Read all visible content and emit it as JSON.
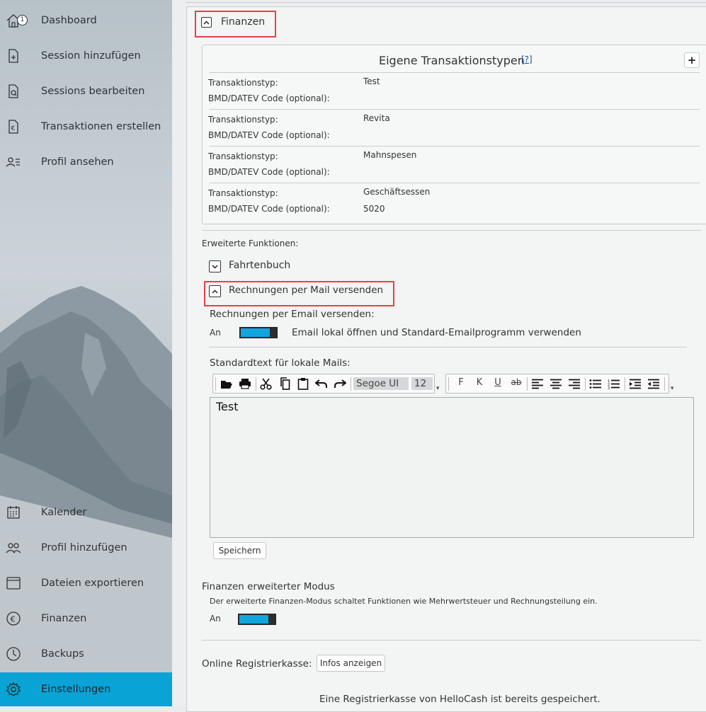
{
  "sidebar": {
    "dashboard_badge": "1",
    "top_items": [
      {
        "label": "Dashboard",
        "icon": "home-icon"
      },
      {
        "label": "Session hinzufügen",
        "icon": "add-document-icon"
      },
      {
        "label": "Sessions bearbeiten",
        "icon": "edit-document-icon"
      },
      {
        "label": "Transaktionen erstellen",
        "icon": "euro-document-icon"
      },
      {
        "label": "Profil ansehen",
        "icon": "profile-list-icon"
      }
    ],
    "bottom_items": [
      {
        "label": "Kalender",
        "icon": "calendar-icon"
      },
      {
        "label": "Profil hinzufügen",
        "icon": "add-profile-icon"
      },
      {
        "label": "Dateien exportieren",
        "icon": "archive-icon"
      },
      {
        "label": "Finanzen",
        "icon": "euro-circle-icon"
      },
      {
        "label": "Backups",
        "icon": "clock-icon"
      },
      {
        "label": "Einstellungen",
        "icon": "gear-icon",
        "active": true
      }
    ],
    "active_color": "#0aa3d6"
  },
  "finanzen": {
    "section_title": "Finanzen",
    "types_box": {
      "title": "Eigene Transaktionstypen",
      "help": "[?]",
      "add_label": "+",
      "rows": [
        {
          "type_label": "Transaktionstyp:",
          "type_value": "Test",
          "code_label": "BMD/DATEV Code (optional):",
          "code_value": ""
        },
        {
          "type_label": "Transaktionstyp:",
          "type_value": "Revita",
          "code_label": "BMD/DATEV Code (optional):",
          "code_value": ""
        },
        {
          "type_label": "Transaktionstyp:",
          "type_value": "Mahnspesen",
          "code_label": "BMD/DATEV Code (optional):",
          "code_value": ""
        },
        {
          "type_label": "Transaktionstyp:",
          "type_value": "Geschäftsessen",
          "code_label": "BMD/DATEV Code (optional):",
          "code_value": "5020"
        }
      ]
    },
    "extended_label": "Erweiterte Funktionen:",
    "fahrtenbuch_label": "Fahrtenbuch",
    "mail_section_title": "Rechnungen per Mail versenden",
    "mail_toggle_label": "Rechnungen per Email versenden:",
    "mail_toggle_state": "An",
    "mail_toggle_desc": "Email lokal öffnen und Standard-Emailprogramm verwenden",
    "standard_text_label": "Standardtext für lokale Mails:",
    "editor": {
      "font_name": "Segoe UI",
      "font_size": "12",
      "bold": "F",
      "italic": "K",
      "underline": "U",
      "strike": "ab",
      "content": "Test"
    },
    "save_label": "Speichern",
    "advanced_title": "Finanzen erweiterter Modus",
    "advanced_desc": "Der erweiterte Finanzen-Modus schaltet Funktionen wie Mehrwertsteuer und Rechnungsteilung ein.",
    "advanced_state": "An",
    "register_label": "Online Registrierkasse:",
    "register_btn": "Infos anzeigen",
    "register_note": "Eine Registrierkasse von HelloCash ist bereits gespeichert."
  },
  "colors": {
    "accent": "#11a6de",
    "highlight": "#e0444b"
  }
}
